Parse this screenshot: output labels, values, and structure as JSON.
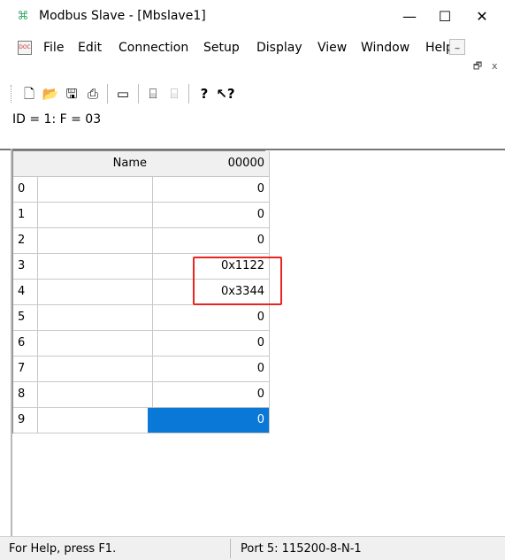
{
  "window": {
    "icon": "app-icon",
    "title": "Modbus Slave - [Mbslave1]",
    "minimize": "—",
    "maximize": "☐",
    "close": "✕"
  },
  "menu": {
    "items": [
      "File",
      "Edit",
      "Connection",
      "Setup",
      "Display",
      "View",
      "Window",
      "Help"
    ],
    "mdi_minimize": "_",
    "mdi_restore": "🗗",
    "mdi_close": "x"
  },
  "toolbar": {
    "buttons": [
      "new-icon",
      "open-icon",
      "save-icon",
      "print-icon",
      "window-icon",
      "connect-icon",
      "disconnect-icon",
      "help-icon",
      "context-help-icon"
    ]
  },
  "info": {
    "text": "ID = 1: F = 03"
  },
  "grid": {
    "headers": [
      "",
      "Name",
      "00000"
    ],
    "rows": [
      {
        "index": "0",
        "name": "",
        "value": "0"
      },
      {
        "index": "1",
        "name": "",
        "value": "0"
      },
      {
        "index": "2",
        "name": "",
        "value": "0"
      },
      {
        "index": "3",
        "name": "",
        "value": "0x1122"
      },
      {
        "index": "4",
        "name": "",
        "value": "0x3344"
      },
      {
        "index": "5",
        "name": "",
        "value": "0"
      },
      {
        "index": "6",
        "name": "",
        "value": "0"
      },
      {
        "index": "7",
        "name": "",
        "value": "0"
      },
      {
        "index": "8",
        "name": "",
        "value": "0"
      },
      {
        "index": "9",
        "name": "",
        "value": "0"
      }
    ],
    "selected_row": 9
  },
  "status": {
    "help": "For Help, press F1.",
    "port": "Port 5: 115200-8-N-1"
  },
  "colors": {
    "selection": "#0a78d7",
    "highlight": "#e8251f"
  }
}
